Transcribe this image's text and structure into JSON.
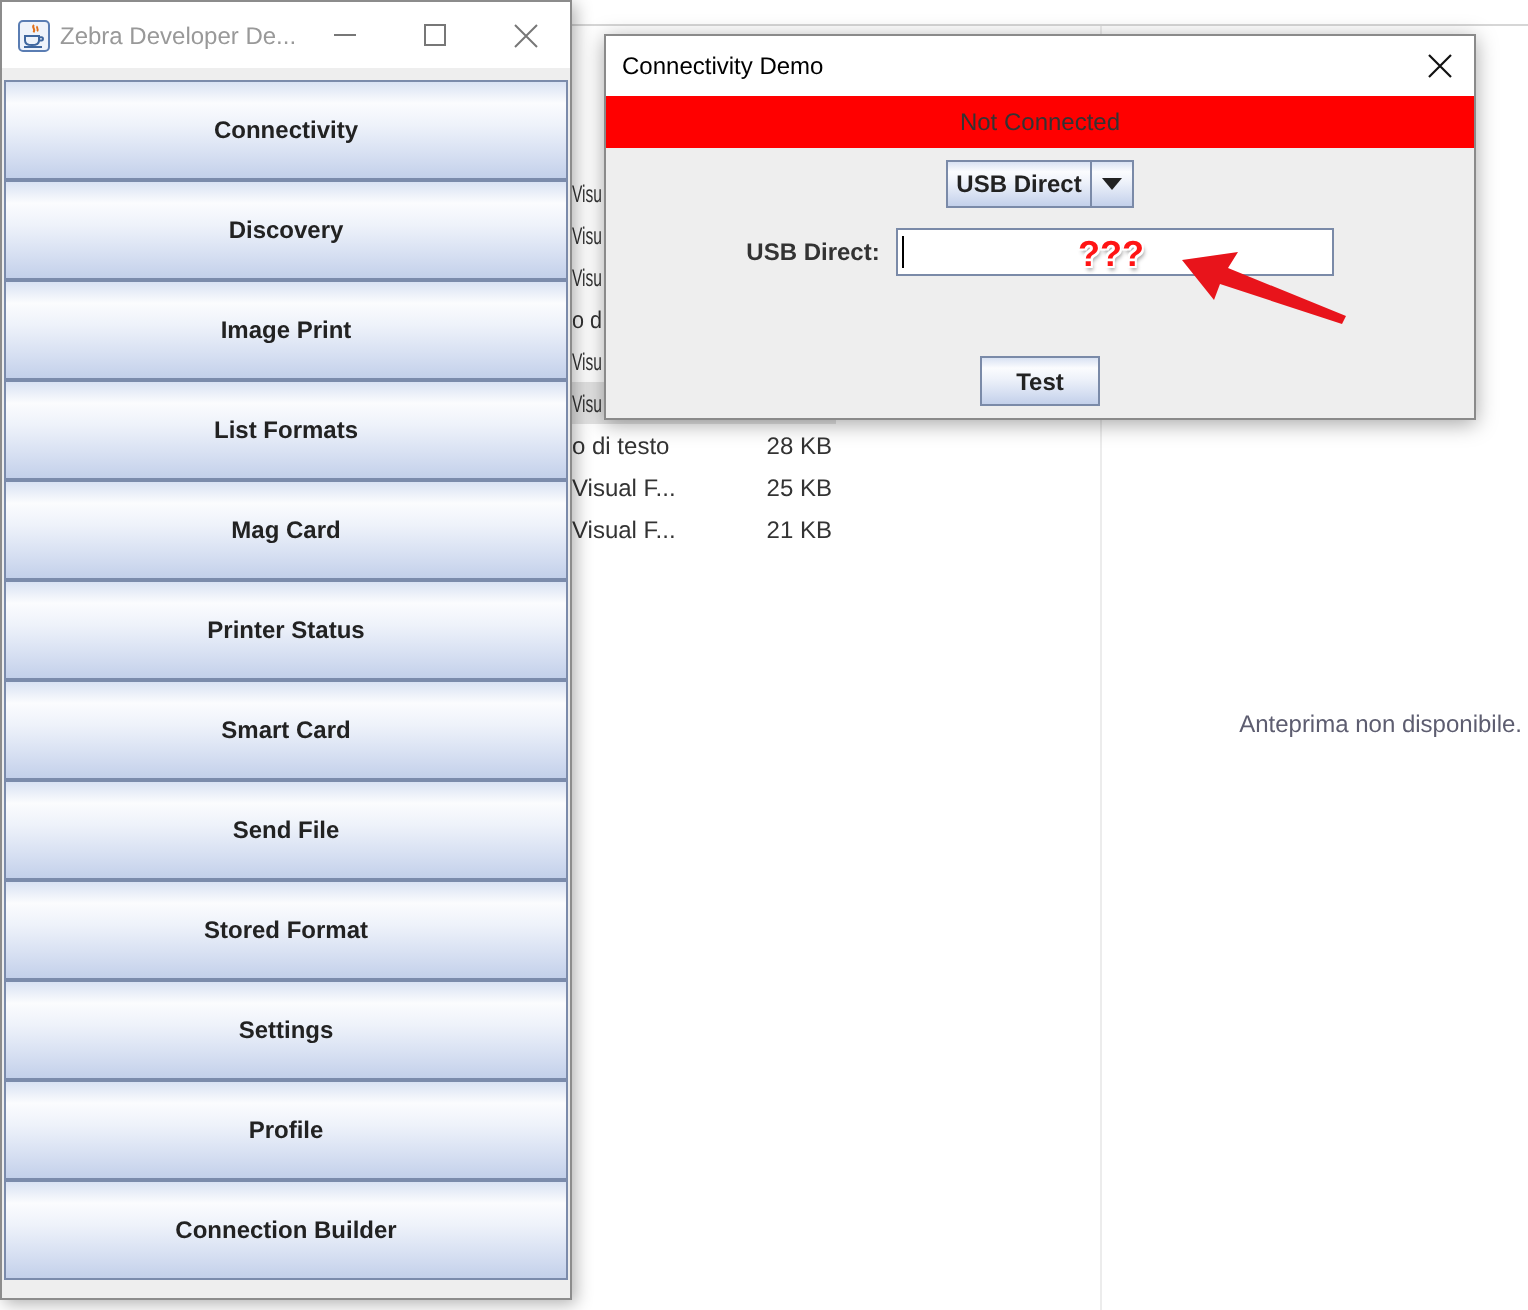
{
  "main_window": {
    "title": "Zebra Developer De...",
    "active": false,
    "buttons": [
      "Connectivity",
      "Discovery",
      "Image Print",
      "List Formats",
      "Mag Card",
      "Printer Status",
      "Smart Card",
      "Send File",
      "Stored Format",
      "Settings",
      "Profile",
      "Connection Builder"
    ]
  },
  "dialog": {
    "title": "Connectivity Demo",
    "status": {
      "text": "Not Connected",
      "connected": false
    },
    "connection_type": "USB Direct",
    "field": {
      "label": "USB Direct:",
      "focused": true
    },
    "buttons": [
      "Test"
    ]
  },
  "annotation": {
    "text": "???"
  },
  "explorer": {
    "rows": [
      {
        "name": "Visu",
        "selected": false
      },
      {
        "name": "Visu",
        "selected": false
      },
      {
        "name": "Visu",
        "selected": false
      },
      {
        "name": "o d",
        "selected": false
      },
      {
        "name": "Visu",
        "selected": false
      },
      {
        "name": "Visu",
        "selected": true
      },
      {
        "name": "o di testo",
        "size": "28 KB",
        "selected": false
      },
      {
        "name": "Visual F...",
        "size": "25 KB",
        "selected": false
      },
      {
        "name": "Visual F...",
        "size": "21 KB",
        "selected": false
      }
    ],
    "preview_message": "Anteprima non disponibile."
  }
}
